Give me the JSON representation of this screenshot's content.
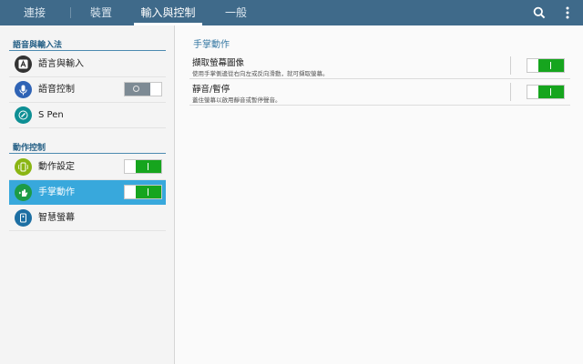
{
  "tabs": [
    {
      "label": "連接"
    },
    {
      "label": "裝置"
    },
    {
      "label": "輸入與控制"
    },
    {
      "label": "一般"
    }
  ],
  "icons": {
    "search": "search-icon",
    "more": "more-vert-icon"
  },
  "sidebar": {
    "section1": "語音與輸入法",
    "section2": "動作控制",
    "items": [
      {
        "label": "語言與輸入",
        "icon": "keyboard-a-icon",
        "color": "#333333"
      },
      {
        "label": "語音控制",
        "icon": "microphone-icon",
        "color": "#2f63b5",
        "toggle": false
      },
      {
        "label": "S Pen",
        "icon": "pen-icon",
        "color": "#0d8f94"
      },
      {
        "label": "動作設定",
        "icon": "motion-icon",
        "color": "#8ab513",
        "toggle": true
      },
      {
        "label": "手掌動作",
        "icon": "palm-icon",
        "color": "#1d9b45",
        "toggle": true
      },
      {
        "label": "智慧螢幕",
        "icon": "smart-screen-icon",
        "color": "#1d6fa3"
      }
    ]
  },
  "content": {
    "title": "手掌動作",
    "rows": [
      {
        "title": "擷取螢幕圖像",
        "subtitle": "使用手掌側邊從右向左或反向滑動，就可擷取螢幕。",
        "toggle": true
      },
      {
        "title": "靜音/暫停",
        "subtitle": "蓋住螢幕以啟用靜音或暫停聲音。",
        "toggle": true
      }
    ]
  },
  "colors": {
    "topbar": "#3f6a8a",
    "selected": "#38a8dc",
    "switch_on": "#16a51e",
    "accent": "#3678a3"
  }
}
